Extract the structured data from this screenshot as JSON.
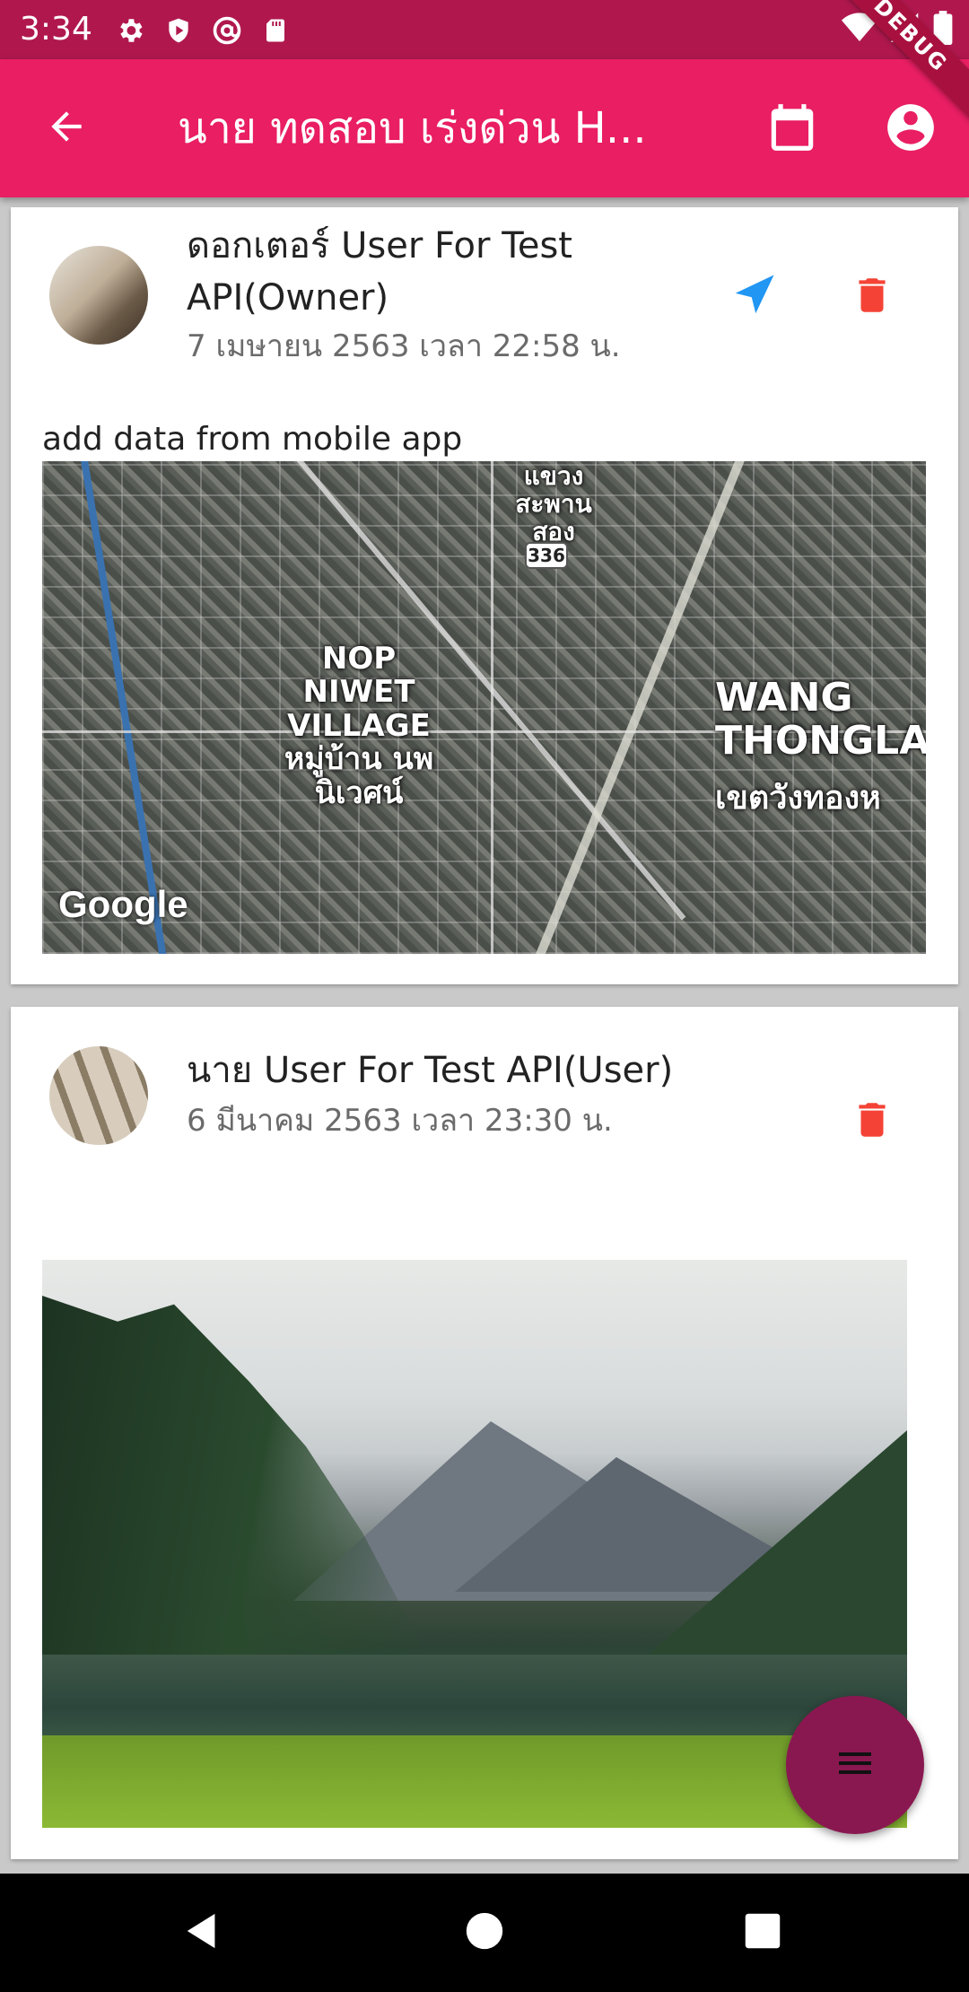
{
  "status_bar": {
    "time": "3:34",
    "icons_left": [
      "settings-icon",
      "shield-icon",
      "at-sign-icon",
      "sd-card-icon"
    ],
    "icons_right": [
      "wifi-icon",
      "signal-icon",
      "battery-icon"
    ],
    "debug_banner": "DEBUG",
    "color": "#b0184d"
  },
  "app_bar": {
    "title": "นาย ทดสอบ เร่งด่วน H...",
    "color": "#e91e63",
    "back_icon": "arrow-back-icon",
    "calendar_icon": "calendar-icon",
    "account_icon": "account-circle-icon"
  },
  "posts": [
    {
      "author": "ดอกเตอร์ User For Test API(Owner)",
      "date": "7 เมษายน 2563 เวลา 22:58 น.",
      "caption": "add data from mobile app",
      "has_location": true,
      "location_icon": "navigation-arrow-icon",
      "delete_icon": "trash-icon",
      "map": {
        "labels": [
          "แขวง สะพานสอง",
          "NOP NIWET VILLAGE หมู่บ้าน นพนิเวศน์",
          "WANG THONGLA",
          "เขตวังทองห"
        ],
        "route_shield": "336",
        "attribution": "Google"
      }
    },
    {
      "author": "นาย User For Test API(User)",
      "date": "6 มีนาคม 2563 เวลา 23:30 น.",
      "caption": "",
      "has_location": false,
      "delete_icon": "trash-icon",
      "image": "mountain-lake-photo"
    }
  ],
  "fab": {
    "icon": "menu-icon",
    "color": "#8a1850"
  },
  "nav_bar": {
    "items": [
      "back-triangle-icon",
      "home-circle-icon",
      "recents-square-icon"
    ]
  },
  "colors": {
    "accent": "#e91e63",
    "location_blue": "#2196f3",
    "delete_red": "#f44336"
  }
}
